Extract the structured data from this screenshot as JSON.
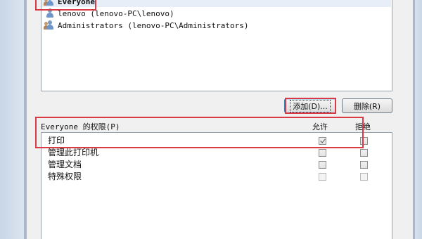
{
  "users": [
    {
      "name": "Everyone",
      "type": "group",
      "selected": true
    },
    {
      "name": "lenovo (lenovo-PC\\lenovo)",
      "type": "user",
      "selected": false
    },
    {
      "name": "Administrators (lenovo-PC\\Administrators)",
      "type": "group",
      "selected": false
    }
  ],
  "buttons": {
    "add": "添加(D)...",
    "remove": "删除(R)"
  },
  "permissions": {
    "label": "Everyone 的权限(P)",
    "allow_header": "允许",
    "deny_header": "拒绝",
    "rows": [
      {
        "name": "打印",
        "allow": true,
        "deny": false
      },
      {
        "name": "管理此打印机",
        "allow": false,
        "deny": false
      },
      {
        "name": "管理文档",
        "allow": false,
        "deny": false
      },
      {
        "name": "特殊权限",
        "allow": false,
        "deny": false
      }
    ]
  },
  "colors": {
    "highlight": "#d93a43",
    "add_button_border": "#3c7fb1"
  }
}
